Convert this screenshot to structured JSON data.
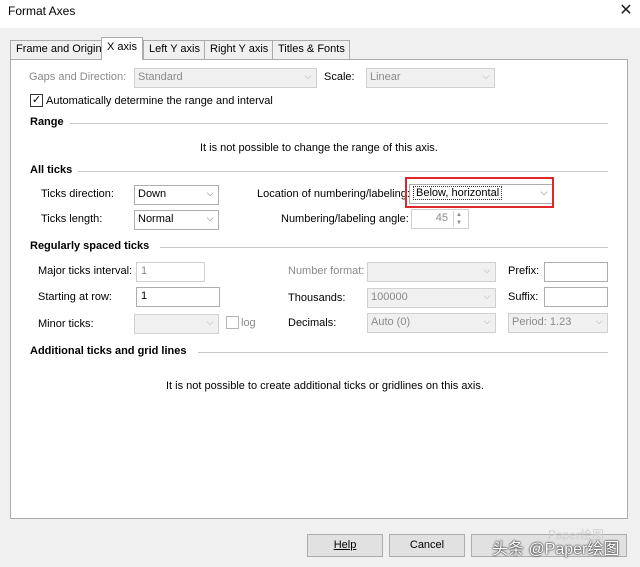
{
  "window": {
    "title": "Format Axes",
    "close_label": "✕"
  },
  "tabs": [
    {
      "label": "Frame and Origin"
    },
    {
      "label": "X axis"
    },
    {
      "label": "Left Y axis"
    },
    {
      "label": "Right Y axis"
    },
    {
      "label": "Titles & Fonts"
    }
  ],
  "gaps": {
    "label": "Gaps and Direction:",
    "value": "Standard",
    "scale_label": "Scale:",
    "scale_value": "Linear"
  },
  "auto_range": {
    "label": "Automatically determine the range and interval",
    "checked": true,
    "check_glyph": "✓"
  },
  "range": {
    "title": "Range",
    "message": "It is not possible to change the range of this axis."
  },
  "all_ticks": {
    "title": "All ticks",
    "direction_label": "Ticks direction:",
    "direction_value": "Down",
    "length_label": "Ticks length:",
    "length_value": "Normal",
    "location_label": "Location of numbering/labeling:",
    "location_value": "Below, horizontal",
    "angle_label": "Numbering/labeling angle:",
    "angle_value": "45"
  },
  "regular": {
    "title": "Regularly spaced ticks",
    "major_label": "Major ticks interval:",
    "major_value": "1",
    "start_label": "Starting at row:",
    "start_value": "1",
    "minor_label": "Minor ticks:",
    "minor_value": "",
    "log_label": "log",
    "number_format_label": "Number format:",
    "number_format_value": "",
    "thousands_label": "Thousands:",
    "thousands_value": "100000",
    "decimals_label": "Decimals:",
    "decimals_value": "Auto (0)",
    "period_value": "Period: 1.23",
    "prefix_label": "Prefix:",
    "prefix_value": "",
    "suffix_label": "Suffix:",
    "suffix_value": ""
  },
  "additional": {
    "title": "Additional ticks and grid lines",
    "message": "It is not possible to create additional ticks or gridlines on this axis."
  },
  "buttons": {
    "help": "Help",
    "cancel": "Cancel",
    "ok": "OK"
  },
  "watermark": {
    "text": "头条 @Paper绘图",
    "faint_text": "Paper绘图"
  }
}
